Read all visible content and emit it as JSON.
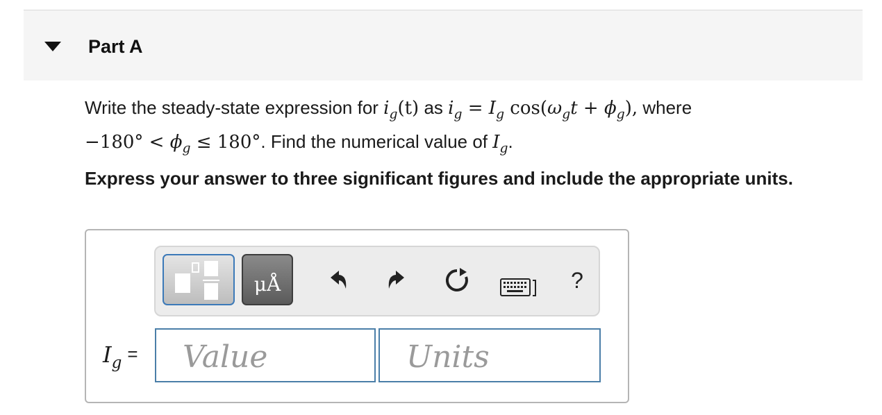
{
  "part": {
    "title": "Part A"
  },
  "question": {
    "p1": "Write the steady-state expression for ",
    "ig": "i",
    "ig_sub": "g",
    "of_t": "(t)",
    "as": " as ",
    "eq": " = ",
    "Ig": "I",
    "Ig_sub": "g",
    "cos": " cos(",
    "omega": "ω",
    "omega_sub": "g",
    "t": "t",
    "plus": " + ",
    "phi": "ϕ",
    "phi_sub": "g",
    "close": "),",
    "where": " where",
    "neg": "−180° < ",
    "leq": " ≤ 180°",
    "p2": ". Find the numerical value of ",
    "period": "."
  },
  "instruction": "Express your answer to three significant figures and include the appropriate units.",
  "toolbar": {
    "units_label": "μÅ",
    "help_label": "?"
  },
  "answer": {
    "var": "I",
    "var_sub": "g",
    "equals": "=",
    "value_placeholder": "Value",
    "units_placeholder": "Units"
  }
}
